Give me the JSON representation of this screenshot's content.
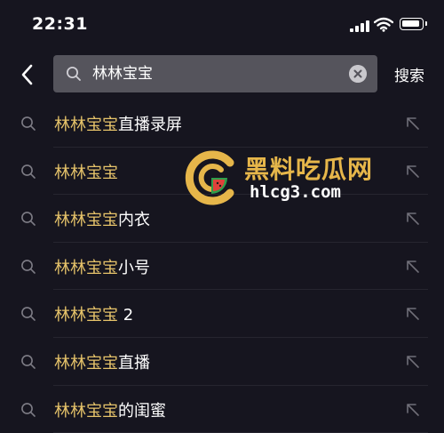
{
  "status_bar": {
    "time": "22:31"
  },
  "header": {
    "search_value": "林林宝宝",
    "search_action_label": "搜索"
  },
  "suggestions": [
    {
      "highlight": "林林宝宝",
      "rest": "直播录屏"
    },
    {
      "highlight": "林林宝宝",
      "rest": ""
    },
    {
      "highlight": "林林宝宝",
      "rest": "内衣"
    },
    {
      "highlight": "林林宝宝",
      "rest": "小号"
    },
    {
      "highlight": "林林宝宝",
      "rest": " 2"
    },
    {
      "highlight": "林林宝宝",
      "rest": "直播"
    },
    {
      "highlight": "林林宝宝",
      "rest": "的闺蜜"
    }
  ],
  "watermark": {
    "title": "黑料吃瓜网",
    "url": "hlcg3.com"
  },
  "colors": {
    "background": "#16151f",
    "search_box": "#55545c",
    "highlight": "#e6c36a",
    "watermark_gold": "#e6b64a"
  },
  "icons": {
    "back": "chevron-left-icon",
    "search": "search-icon",
    "clear": "clear-circle-icon",
    "fill": "arrow-up-left-icon"
  }
}
